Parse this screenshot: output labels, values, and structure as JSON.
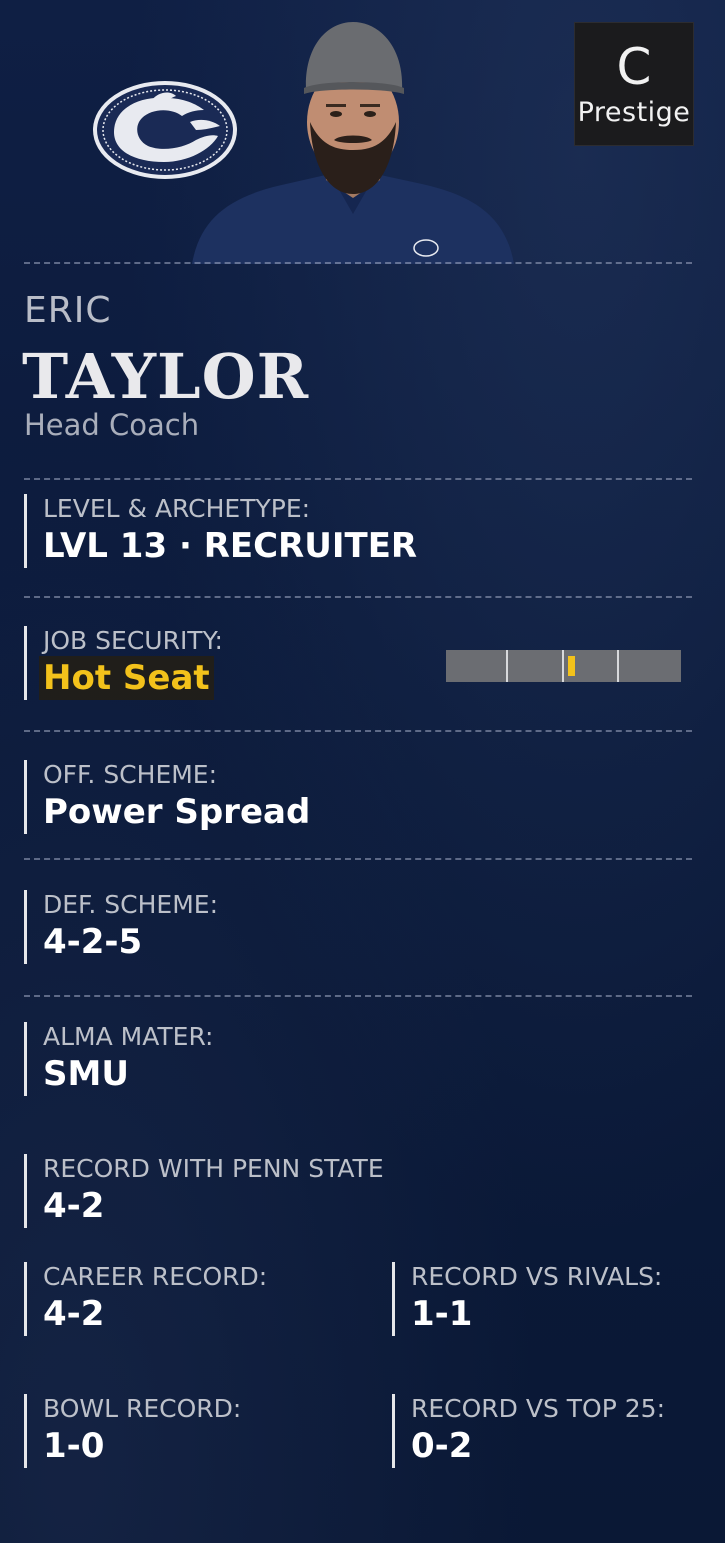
{
  "header": {
    "prestige_grade": "C",
    "prestige_label": "Prestige"
  },
  "coach": {
    "first_name": "ERIC",
    "last_name": "TAYLOR",
    "role": "Head Coach"
  },
  "fields": {
    "level": {
      "label": "LEVEL & ARCHETYPE:",
      "value": "LVL 13 · RECRUITER"
    },
    "job_security": {
      "label": "JOB SECURITY:",
      "value": "Hot Seat",
      "meter_fraction": 0.52
    },
    "off_scheme": {
      "label": "OFF. SCHEME:",
      "value": "Power Spread"
    },
    "def_scheme": {
      "label": "DEF. SCHEME:",
      "value": "4-2-5"
    },
    "alma_mater": {
      "label": "ALMA MATER:",
      "value": "SMU"
    },
    "record_team": {
      "label": "RECORD WITH PENN STATE",
      "value": "4-2"
    },
    "career_record": {
      "label": "CAREER RECORD:",
      "value": "4-2"
    },
    "record_rivals": {
      "label": "RECORD VS RIVALS:",
      "value": "1-1"
    },
    "bowl_record": {
      "label": "BOWL RECORD:",
      "value": "1-0"
    },
    "record_top25": {
      "label": "RECORD VS TOP 25:",
      "value": "0-2"
    }
  },
  "colors": {
    "background": "#0c1a38",
    "accent_hot": "#f3c21b",
    "label": "#bcc0c9"
  },
  "icons": {
    "team_logo": "nittany-lion-logo-icon",
    "coach_portrait": "coach-portrait"
  }
}
